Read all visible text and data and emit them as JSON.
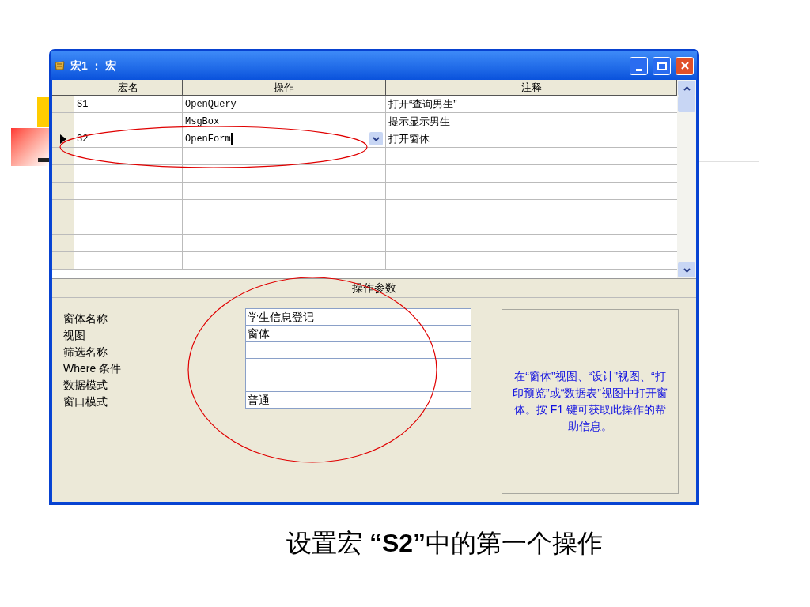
{
  "window": {
    "title": "宏1 ： 宏"
  },
  "grid": {
    "columns": [
      "宏名",
      "操作",
      "注释"
    ],
    "rows": [
      {
        "name": "S1",
        "action": "OpenQuery",
        "comment": "打开“查询男生”",
        "selected": false
      },
      {
        "action": "MsgBox",
        "comment": "提示显示男生",
        "selected": false
      },
      {
        "name": "S2",
        "action": "OpenForm",
        "comment": "打开窗体",
        "selected": true
      }
    ]
  },
  "params": {
    "title": "操作参数",
    "fields": [
      {
        "label": "窗体名称",
        "value": "学生信息登记"
      },
      {
        "label": "视图",
        "value": "窗体"
      },
      {
        "label": "筛选名称"
      },
      {
        "label": "Where 条件"
      },
      {
        "label": "数据模式"
      },
      {
        "label": "窗口模式",
        "value": "普通"
      }
    ],
    "help": "在“窗体”视图、“设计”视图、“打印预览”或“数据表”视图中打开窗体。按 F1 键可获取此操作的帮助信息。"
  },
  "caption": "设置宏 **“S2”**中的第一个操作"
}
